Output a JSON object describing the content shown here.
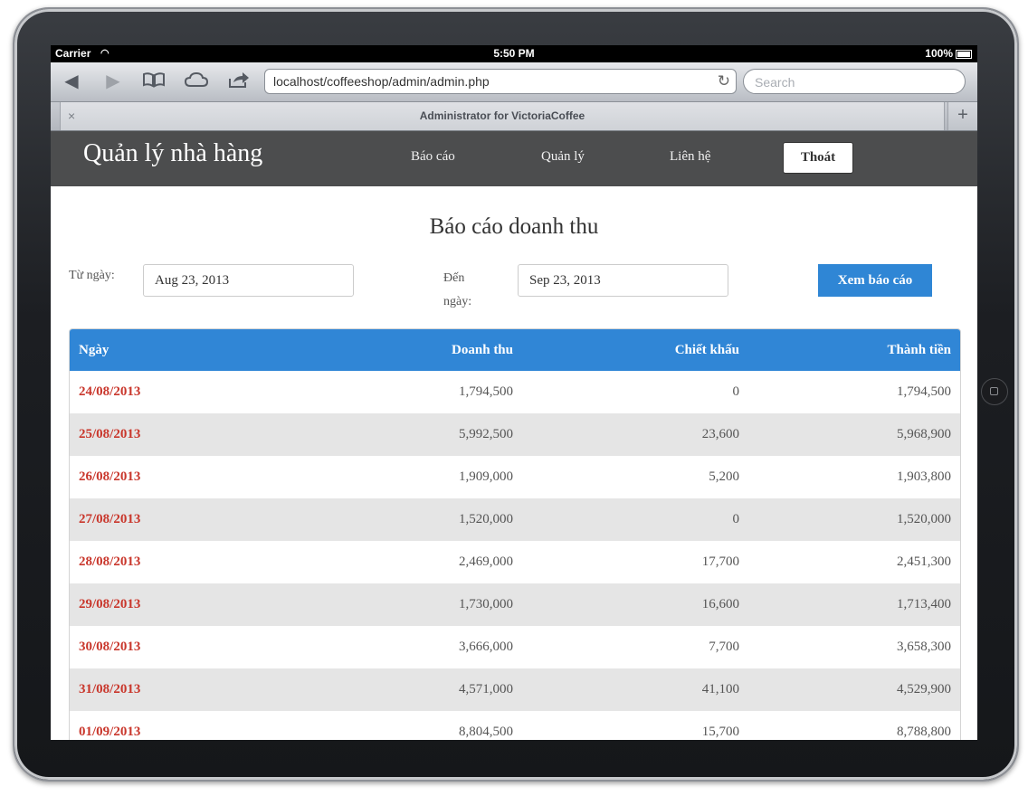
{
  "status_bar": {
    "carrier": "Carrier",
    "time": "5:50 PM",
    "battery": "100%"
  },
  "browser": {
    "url": "localhost/coffeeshop/admin/admin.php",
    "search_placeholder": "Search",
    "tab_title": "Administrator for VictoriaCoffee",
    "tab_close": "×",
    "tab_add": "+"
  },
  "nav": {
    "brand": "Quản lý nhà hàng",
    "links": [
      "Báo cáo",
      "Quản lý",
      "Liên hệ"
    ],
    "logout": "Thoát"
  },
  "report": {
    "title": "Báo cáo doanh thu",
    "from_label": "Từ ngày:",
    "from_value": "Aug 23, 2013",
    "to_label": "Đến ngày:",
    "to_value": "Sep 23, 2013",
    "submit": "Xem báo cáo"
  },
  "table": {
    "headers": [
      "Ngày",
      "Doanh thu",
      "Chiết khấu",
      "Thành tiền"
    ],
    "rows": [
      [
        "24/08/2013",
        "1,794,500",
        "0",
        "1,794,500"
      ],
      [
        "25/08/2013",
        "5,992,500",
        "23,600",
        "5,968,900"
      ],
      [
        "26/08/2013",
        "1,909,000",
        "5,200",
        "1,903,800"
      ],
      [
        "27/08/2013",
        "1,520,000",
        "0",
        "1,520,000"
      ],
      [
        "28/08/2013",
        "2,469,000",
        "17,700",
        "2,451,300"
      ],
      [
        "29/08/2013",
        "1,730,000",
        "16,600",
        "1,713,400"
      ],
      [
        "30/08/2013",
        "3,666,000",
        "7,700",
        "3,658,300"
      ],
      [
        "31/08/2013",
        "4,571,000",
        "41,100",
        "4,529,900"
      ],
      [
        "01/09/2013",
        "8,804,500",
        "15,700",
        "8,788,800"
      ]
    ]
  },
  "colors": {
    "nav_bg": "#4c4d4e",
    "accent": "#2f86d5",
    "date_link": "#c9372c",
    "stripe": "#e5e5e5"
  }
}
